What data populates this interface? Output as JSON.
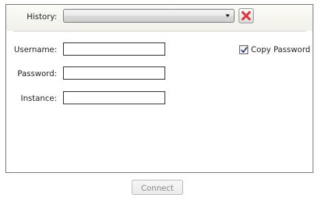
{
  "history": {
    "label": "History:",
    "selected_value": "",
    "clear_icon": "red-x-icon"
  },
  "form": {
    "username_label": "Username:",
    "username_value": "",
    "password_label": "Password:",
    "password_value": "",
    "instance_label": "Instance:",
    "instance_value": "",
    "copy_password_label": "Copy Password",
    "copy_password_checked": true
  },
  "actions": {
    "connect_label": "Connect",
    "connect_enabled": false
  },
  "colors": {
    "clear_icon_red": "#d8202a",
    "checkmark": "#1f2f7a",
    "disabled_text": "#8a8a8a"
  }
}
